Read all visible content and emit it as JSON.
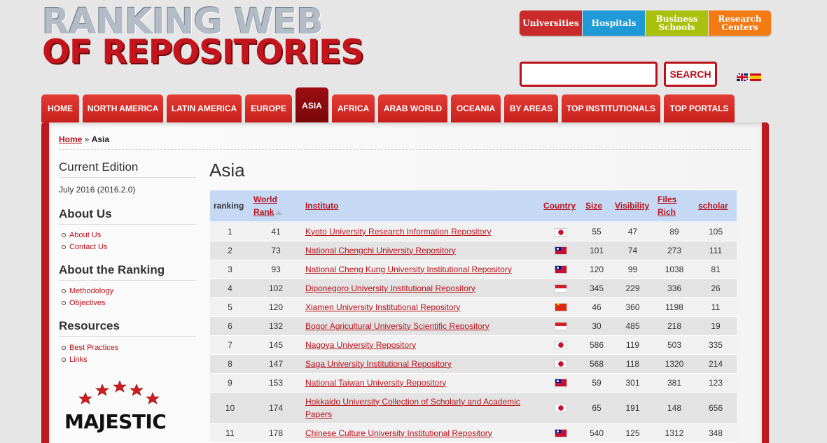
{
  "logo": {
    "line1": "RANKING WEB",
    "line2": "OF REPOSITORIES"
  },
  "categories": [
    {
      "label": "Universities"
    },
    {
      "label": "Hospitals"
    },
    {
      "label": "Business Schools"
    },
    {
      "label": "Research Centers"
    }
  ],
  "search": {
    "value": "",
    "button_label": "SEARCH"
  },
  "nav": [
    {
      "label": "HOME"
    },
    {
      "label": "NORTH AMERICA"
    },
    {
      "label": "LATIN AMERICA"
    },
    {
      "label": "EUROPE"
    },
    {
      "label": "ASIA"
    },
    {
      "label": "AFRICA"
    },
    {
      "label": "ARAB WORLD"
    },
    {
      "label": "OCEANIA"
    },
    {
      "label": "BY AREAS"
    },
    {
      "label": "TOP INSTITUTIONALS"
    },
    {
      "label": "TOP PORTALS"
    }
  ],
  "breadcrumb": {
    "home": "Home",
    "sep": " » ",
    "current": "Asia"
  },
  "sidebar": {
    "edition_title": "Current Edition",
    "edition_value": "July 2016 (2016.2.0)",
    "about_title": "About Us",
    "about_links": [
      "About Us",
      "Contact Us"
    ],
    "ranking_title": "About the Ranking",
    "ranking_links": [
      "Methodology",
      "Objectives"
    ],
    "resources_title": "Resources",
    "resources_links": [
      "Best Practices",
      "Links"
    ],
    "majestic": "MAJESTIC"
  },
  "page_title": "Asia",
  "table": {
    "headers": {
      "ranking": "ranking",
      "world_rank_1": "World",
      "world_rank_2": "Rank",
      "instituto": "Instituto",
      "country": "Country",
      "size": "Size",
      "visibility": "Visibility",
      "files_rich_1": "Files",
      "files_rich_2": "Rich",
      "scholar": "scholar"
    },
    "rows": [
      {
        "ranking": "1",
        "world_rank": "41",
        "name": "Kyoto University Research Information Repository",
        "country": "jp",
        "size": "55",
        "visibility": "47",
        "files_rich": "89",
        "scholar": "105"
      },
      {
        "ranking": "2",
        "world_rank": "73",
        "name": "National Chengchi University Repository",
        "country": "tw",
        "size": "101",
        "visibility": "74",
        "files_rich": "273",
        "scholar": "111"
      },
      {
        "ranking": "3",
        "world_rank": "93",
        "name": "National Cheng Kung University Institutional Repository",
        "country": "tw",
        "size": "120",
        "visibility": "99",
        "files_rich": "1038",
        "scholar": "81"
      },
      {
        "ranking": "4",
        "world_rank": "102",
        "name": "Diponegoro University Institutional Repository",
        "country": "id",
        "size": "345",
        "visibility": "229",
        "files_rich": "336",
        "scholar": "26"
      },
      {
        "ranking": "5",
        "world_rank": "120",
        "name": "Xiamen University Institutional Repository",
        "country": "cn",
        "size": "46",
        "visibility": "360",
        "files_rich": "1198",
        "scholar": "11"
      },
      {
        "ranking": "6",
        "world_rank": "132",
        "name": "Bogor Agricultural University Scientific Repository",
        "country": "id",
        "size": "30",
        "visibility": "485",
        "files_rich": "218",
        "scholar": "19"
      },
      {
        "ranking": "7",
        "world_rank": "145",
        "name": "Nagoya University Repository",
        "country": "jp",
        "size": "586",
        "visibility": "119",
        "files_rich": "503",
        "scholar": "335"
      },
      {
        "ranking": "8",
        "world_rank": "147",
        "name": "Saga University Institutional Repository",
        "country": "jp",
        "size": "568",
        "visibility": "118",
        "files_rich": "1320",
        "scholar": "214"
      },
      {
        "ranking": "9",
        "world_rank": "153",
        "name": "National Taiwan University Repository",
        "country": "tw",
        "size": "59",
        "visibility": "301",
        "files_rich": "381",
        "scholar": "123"
      },
      {
        "ranking": "10",
        "world_rank": "174",
        "name": "Hokkaido University Collection of Scholarly and Academic Papers",
        "country": "jp",
        "size": "65",
        "visibility": "191",
        "files_rich": "148",
        "scholar": "656"
      },
      {
        "ranking": "11",
        "world_rank": "178",
        "name": "Chinese Culture University Institutional Repository",
        "country": "tw",
        "size": "540",
        "visibility": "125",
        "files_rich": "1312",
        "scholar": "348"
      }
    ]
  }
}
